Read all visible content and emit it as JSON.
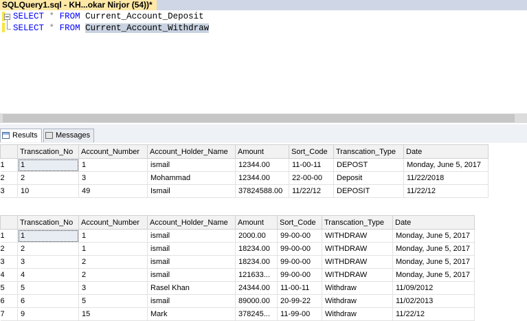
{
  "tab": {
    "title": "SQLQuery1.sql - KH...okar Nirjor (54))*"
  },
  "editor": {
    "lines": [
      {
        "select": "SELECT",
        "star": "*",
        "from": "FROM",
        "table": "Current_Account_Deposit"
      },
      {
        "select": "SELECT",
        "star": "*",
        "from": "FROM",
        "table": "Current_Account_Withdraw"
      }
    ]
  },
  "results_tabs": {
    "results": "Results",
    "messages": "Messages"
  },
  "grid1": {
    "headers": [
      "Transcation_No",
      "Account_Number",
      "Account_Holder_Name",
      "Amount",
      "Sort_Code",
      "Transcation_Type",
      "Date"
    ],
    "rows": [
      {
        "rn": "1",
        "cells": [
          "1",
          "1",
          "ismail",
          "12344.00",
          "11-00-11",
          "DEPOST",
          "Monday, June 5, 2017"
        ]
      },
      {
        "rn": "2",
        "cells": [
          "2",
          "3",
          "Mohammad",
          "12344.00",
          "22-00-00",
          "Deposit",
          "11/22/2018"
        ]
      },
      {
        "rn": "3",
        "cells": [
          "10",
          "49",
          "Ismail",
          "37824588.00",
          "11/22/12",
          "DEPOSIT",
          "11/22/12"
        ]
      }
    ]
  },
  "grid2": {
    "headers": [
      "Transcation_No",
      "Account_Number",
      "Account_Holder_Name",
      "Amount",
      "Sort_Code",
      "Transcation_Type",
      "Date"
    ],
    "rows": [
      {
        "rn": "1",
        "cells": [
          "1",
          "1",
          "ismail",
          "2000.00",
          "99-00-00",
          "WITHDRAW",
          "Monday, June 5, 2017"
        ]
      },
      {
        "rn": "2",
        "cells": [
          "2",
          "1",
          "ismail",
          "18234.00",
          "99-00-00",
          "WITHDRAW",
          "Monday, June 5, 2017"
        ]
      },
      {
        "rn": "3",
        "cells": [
          "3",
          "2",
          "ismail",
          "18234.00",
          "99-00-00",
          "WITHDRAW",
          "Monday, June 5, 2017"
        ]
      },
      {
        "rn": "4",
        "cells": [
          "4",
          "2",
          "ismail",
          "121633...",
          "99-00-00",
          "WITHDRAW",
          "Monday, June 5, 2017"
        ]
      },
      {
        "rn": "5",
        "cells": [
          "5",
          "3",
          "Rasel Khan",
          "24344.00",
          "11-00-11",
          "Withdraw",
          "11/09/2012"
        ]
      },
      {
        "rn": "6",
        "cells": [
          "6",
          "5",
          "ismail",
          "89000.00",
          "20-99-22",
          "Withdraw",
          "11/02/2013"
        ]
      },
      {
        "rn": "7",
        "cells": [
          "9",
          "15",
          "Mark",
          "378245...",
          "11-99-00",
          "Withdraw",
          "11/22/12"
        ]
      }
    ]
  },
  "colors": {
    "keyword": "#0000ff",
    "tab_active": "#ffe8a6",
    "selection": "#c8d2e0"
  }
}
